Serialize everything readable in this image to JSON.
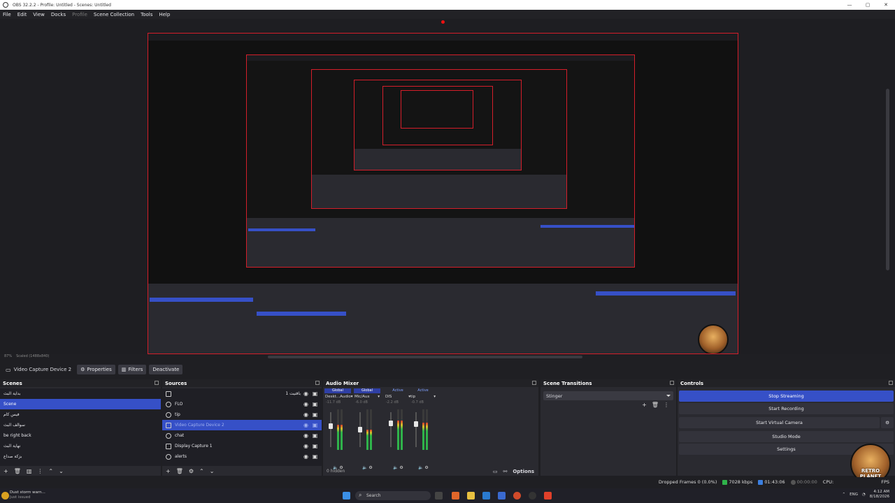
{
  "window": {
    "title": "OBS 32.2.2 - Profile: Untitled - Scenes: Untitled",
    "controls": [
      "—",
      "▢",
      "✕"
    ]
  },
  "menu": {
    "items": [
      "File",
      "Edit",
      "View",
      "Docks"
    ],
    "disabled": "Profile",
    "items2": [
      "Scene Collection",
      "Tools",
      "Help"
    ]
  },
  "preview": {
    "zoom": "87%",
    "scaled": "Scaled (1488x840)"
  },
  "source_toolbar": {
    "source_name": "Video Capture Device 2",
    "properties": "Properties",
    "filters": "Filters",
    "deactivate": "Deactivate"
  },
  "scenes": {
    "title": "Scenes",
    "items": [
      "بداية البث",
      "Scene",
      "فيس كام",
      "سوالف البث",
      "be right back",
      "نهاية البث",
      "بزكة صداع"
    ],
    "active_index": 1
  },
  "sources": {
    "title": "Sources",
    "items": [
      {
        "name": "",
        "arabic": "باقتيت 1"
      },
      {
        "name": "FLO"
      },
      {
        "name": "tip"
      },
      {
        "name": "Video Capture Device 2"
      },
      {
        "name": "chat"
      },
      {
        "name": "Display Capture 1"
      },
      {
        "name": "alerts"
      }
    ],
    "active_index": 3
  },
  "mixer": {
    "title": "Audio Mixer",
    "channels": [
      {
        "head": "Global",
        "name": "Deskt...Audio",
        "db": "-11.7 dB",
        "level": 0.62
      },
      {
        "head": "Global",
        "name": "Mic/Aux",
        "db": "-6.0 dB",
        "level": 0.5
      },
      {
        "head": "Active",
        "name": "DIS",
        "db": "-2.2 dB",
        "level": 0.72
      },
      {
        "head": "Active",
        "name": "tip",
        "db": "-0.7 dB",
        "level": 0.68
      }
    ],
    "hidden": "0 hidden",
    "options": "Options"
  },
  "transitions": {
    "title": "Scene Transitions",
    "selected": "Stinger"
  },
  "controls": {
    "title": "Controls",
    "stop_streaming": "Stop Streaming",
    "start_recording": "Start Recording",
    "start_virtual_camera": "Start Virtual Camera",
    "studio_mode": "Studio Mode",
    "settings": "Settings"
  },
  "status": {
    "dropped": "Dropped Frames 0 (0.0%)",
    "bitrate": "7028 kbps",
    "stream_time": "01:43:06",
    "record_time": "00:00:00",
    "cpu": "CPU:",
    "fps": "FPS"
  },
  "taskbar": {
    "weather_title": "Dust storm warn...",
    "weather_sub": "Just issued",
    "search": "Search",
    "lang": "ENG",
    "time": "4:12 AM",
    "date": "8/18/2026"
  },
  "logo_text": "RETRO PLANET",
  "colors": {
    "accent": "#3650c7",
    "record_border": "#d41e2a"
  }
}
